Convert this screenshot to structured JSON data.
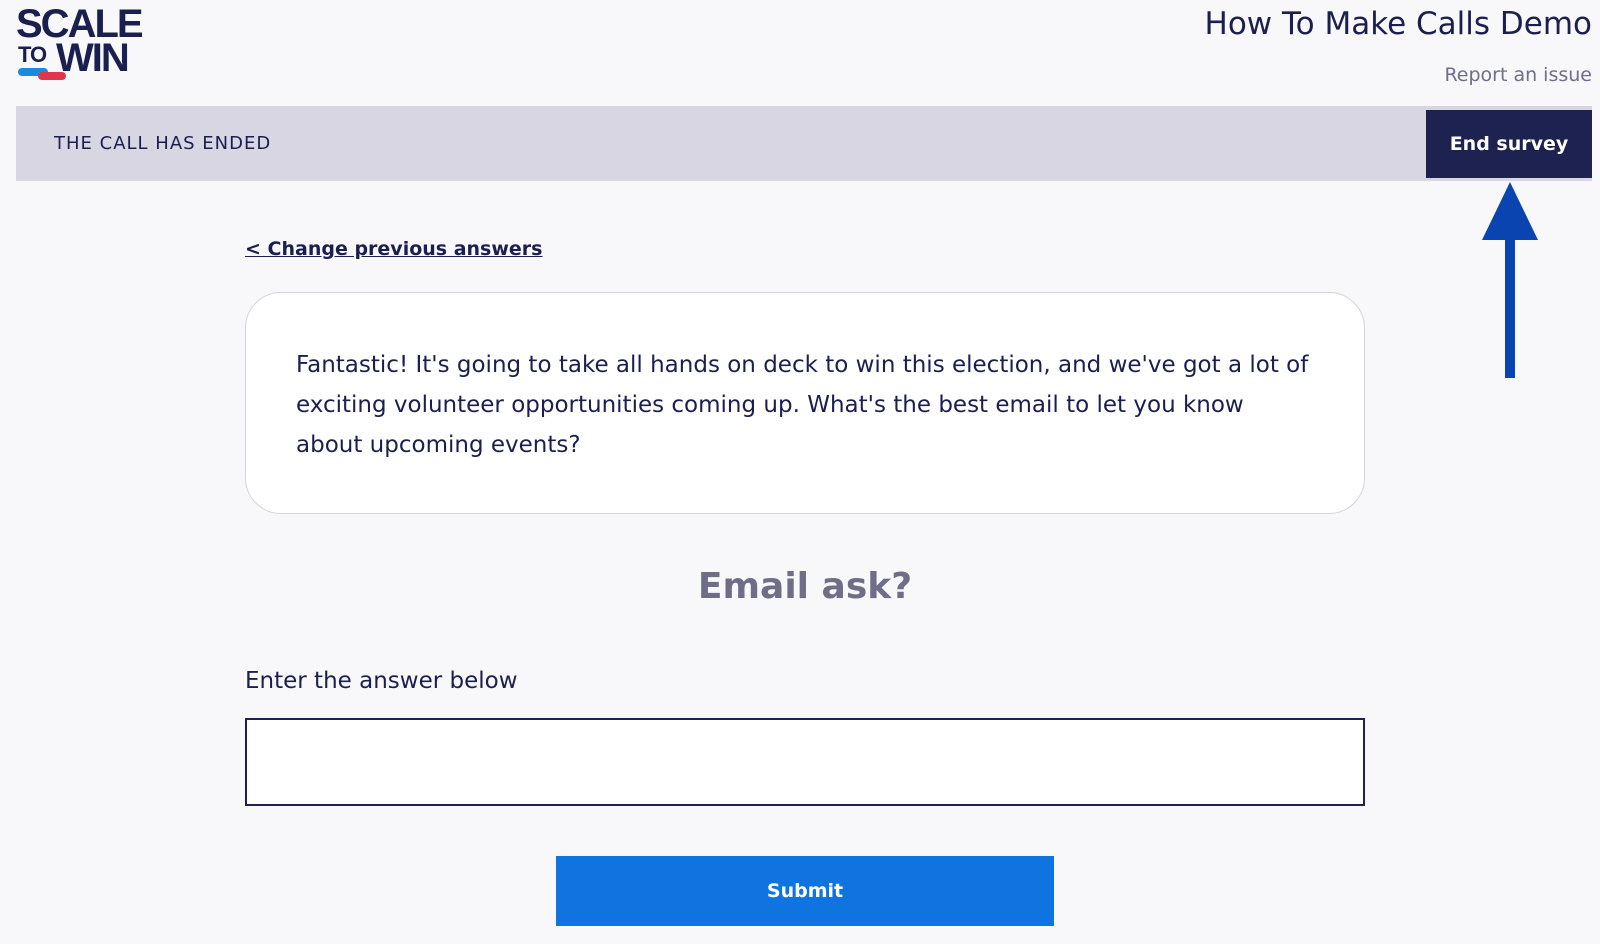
{
  "logo": {
    "line1": "SCALE",
    "line2_small": "TO",
    "line2_large": "WIN",
    "colors": {
      "navy": "#1a1f4e",
      "blue": "#1b8be0",
      "red": "#e0354a"
    }
  },
  "header": {
    "title": "How To Make Calls Demo",
    "report_link": "Report an issue"
  },
  "status_bar": {
    "text": "THE CALL HAS ENDED",
    "end_survey_label": "End survey"
  },
  "annotation": {
    "arrow_color": "#0a44b0",
    "arrow_icon": "up-arrow-icon"
  },
  "survey": {
    "back_link": "< Change previous answers",
    "script": "Fantastic! It's going to take all hands on deck to win this election, and we've got a lot of exciting volunteer opportunities coming up. What's the best email to let you know about upcoming events?",
    "question": "Email ask?",
    "answer_label": "Enter the answer below",
    "answer_value": "",
    "answer_placeholder": "",
    "submit_label": "Submit"
  },
  "colors": {
    "background": "#f8f8fa",
    "status_bar": "#d8d6e2",
    "end_survey_bg": "#1e2250",
    "submit_bg": "#0f74e0",
    "muted_text": "#6f6d87"
  }
}
